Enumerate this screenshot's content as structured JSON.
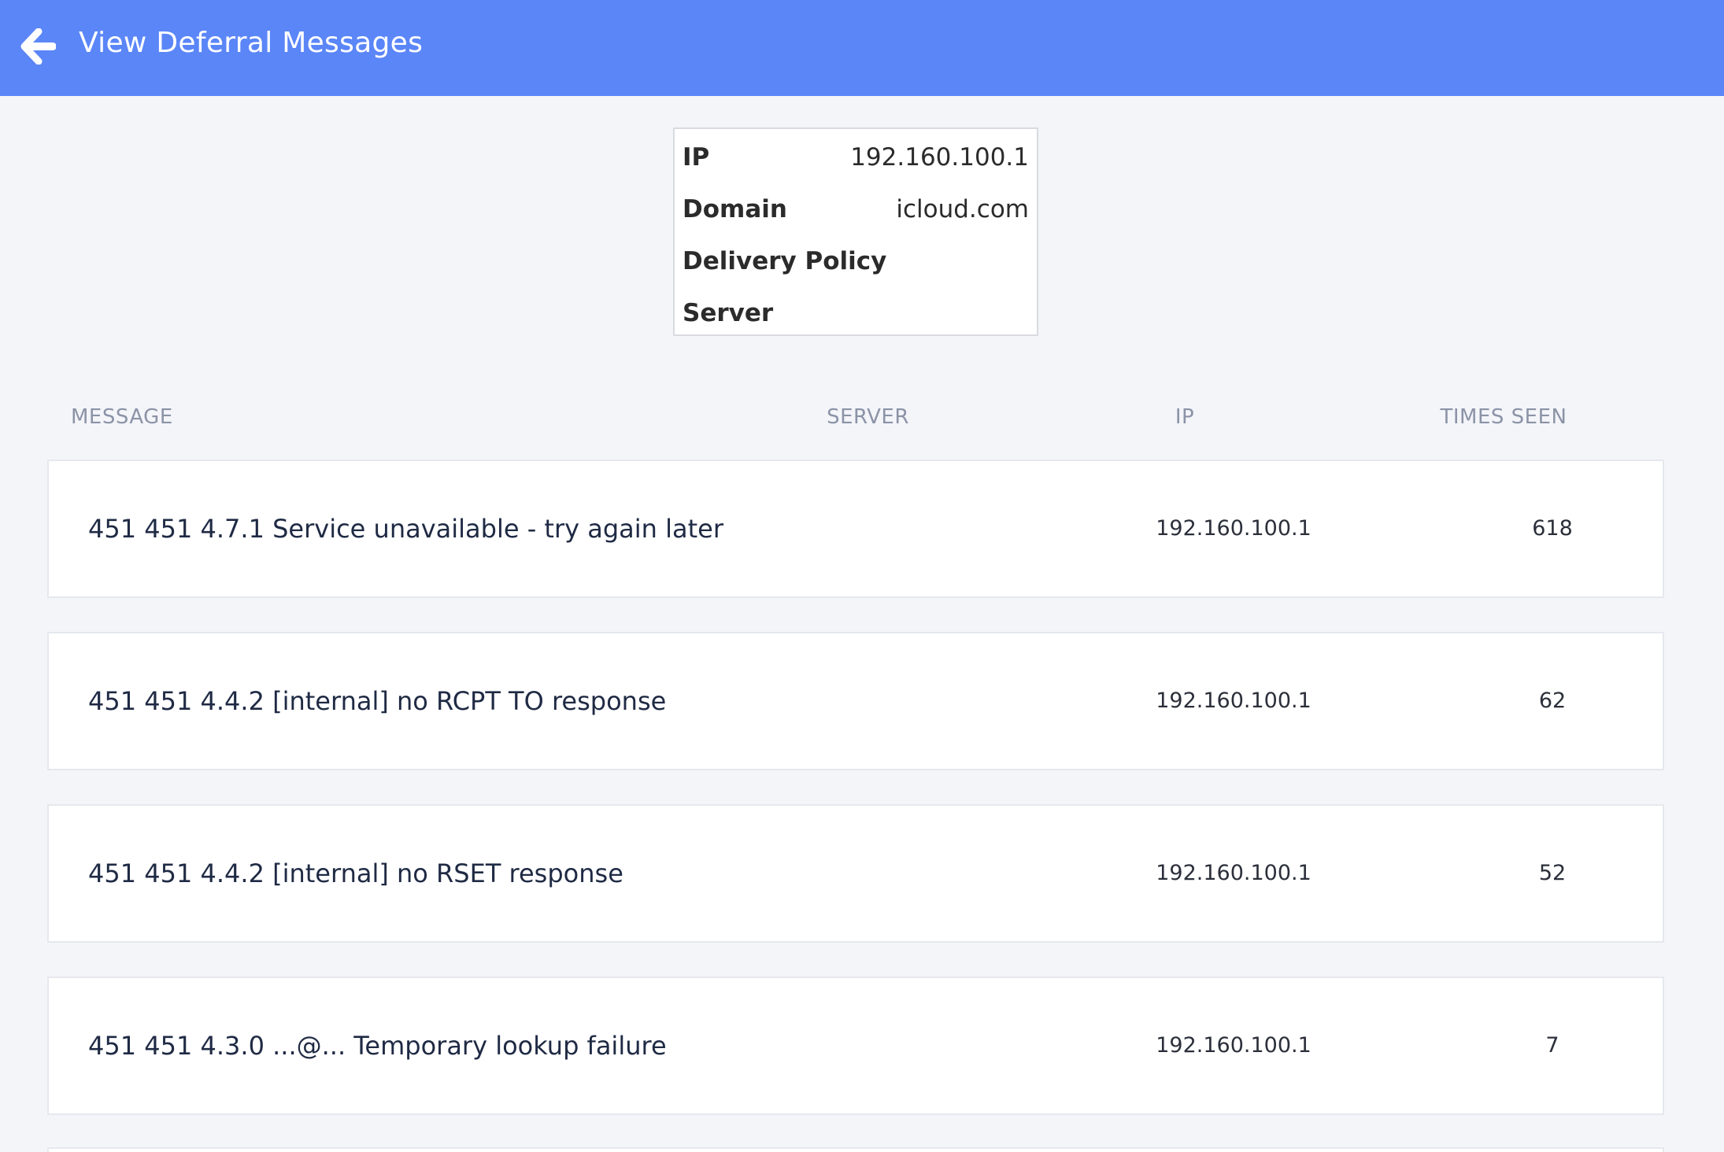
{
  "header": {
    "title": "View Deferral Messages",
    "back_icon": "arrow-left-icon",
    "background_color": "#5b86f8"
  },
  "info": {
    "rows": [
      {
        "label": "IP",
        "value": "192.160.100.1"
      },
      {
        "label": "Domain",
        "value": "icloud.com"
      },
      {
        "label": "Delivery Policy",
        "value": ""
      },
      {
        "label": "Server",
        "value": ""
      }
    ]
  },
  "table": {
    "columns": {
      "message": "MESSAGE",
      "server": "SERVER",
      "ip": "IP",
      "times_seen": "TIMES SEEN"
    },
    "rows": [
      {
        "message": "451 451 4.7.1 Service unavailable - try again later",
        "server": "",
        "ip": "192.160.100.1",
        "times_seen": "618"
      },
      {
        "message": "451 451 4.4.2 [internal] no RCPT TO response",
        "server": "",
        "ip": "192.160.100.1",
        "times_seen": "62"
      },
      {
        "message": "451 451 4.4.2 [internal] no RSET response",
        "server": "",
        "ip": "192.160.100.1",
        "times_seen": "52"
      },
      {
        "message": "451 451 4.3.0 ...@... Temporary lookup failure",
        "server": "",
        "ip": "192.160.100.1",
        "times_seen": "7"
      }
    ]
  }
}
